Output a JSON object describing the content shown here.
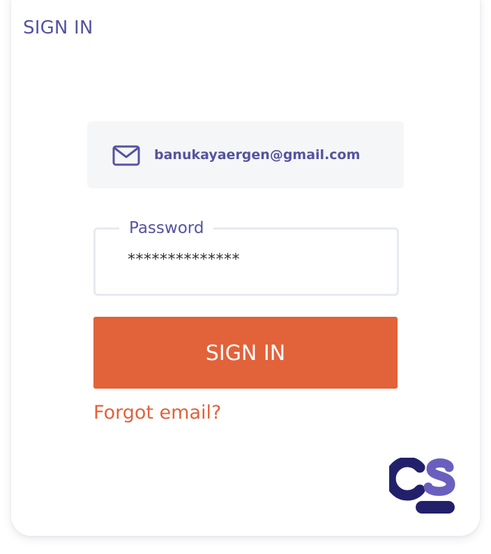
{
  "header": {
    "title": "SIGN IN"
  },
  "email": {
    "icon": "mail-icon",
    "value": "banukayaergen@gmail.com"
  },
  "password": {
    "label": "Password",
    "value": "**************"
  },
  "signin_button": {
    "label": "SIGN IN"
  },
  "forgot_link": {
    "label": "Forgot email?"
  },
  "logo": {
    "text": "CS",
    "icon": "cs-logo"
  },
  "colors": {
    "primary": "#5553a0",
    "accent": "#e2623a",
    "logo_dark": "#23206b",
    "logo_light": "#6a5fbf",
    "field_bg": "#f5f6f8",
    "field_border": "#e6ebf0"
  }
}
